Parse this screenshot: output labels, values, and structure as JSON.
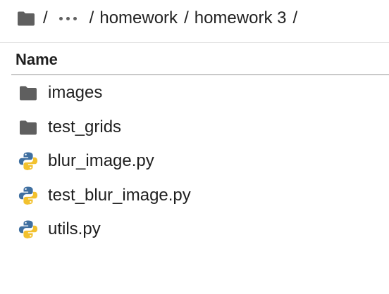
{
  "breadcrumb": {
    "root_icon": "folder-icon",
    "sep1": "/",
    "ellipsis_icon": "ellipsis-icon",
    "sep2": "/",
    "item1": "homework",
    "sep3": "/",
    "item2": "homework 3",
    "sep4": "/"
  },
  "table": {
    "column_name": "Name"
  },
  "files": [
    {
      "name": "images",
      "icon": "folder-icon"
    },
    {
      "name": "test_grids",
      "icon": "folder-icon"
    },
    {
      "name": "blur_image.py",
      "icon": "python-file-icon"
    },
    {
      "name": "test_blur_image.py",
      "icon": "python-file-icon"
    },
    {
      "name": "utils.py",
      "icon": "python-file-icon"
    }
  ],
  "colors": {
    "folder": "#5f5f5f",
    "python_blue": "#3f6fa0",
    "python_yellow": "#f2c12e"
  }
}
